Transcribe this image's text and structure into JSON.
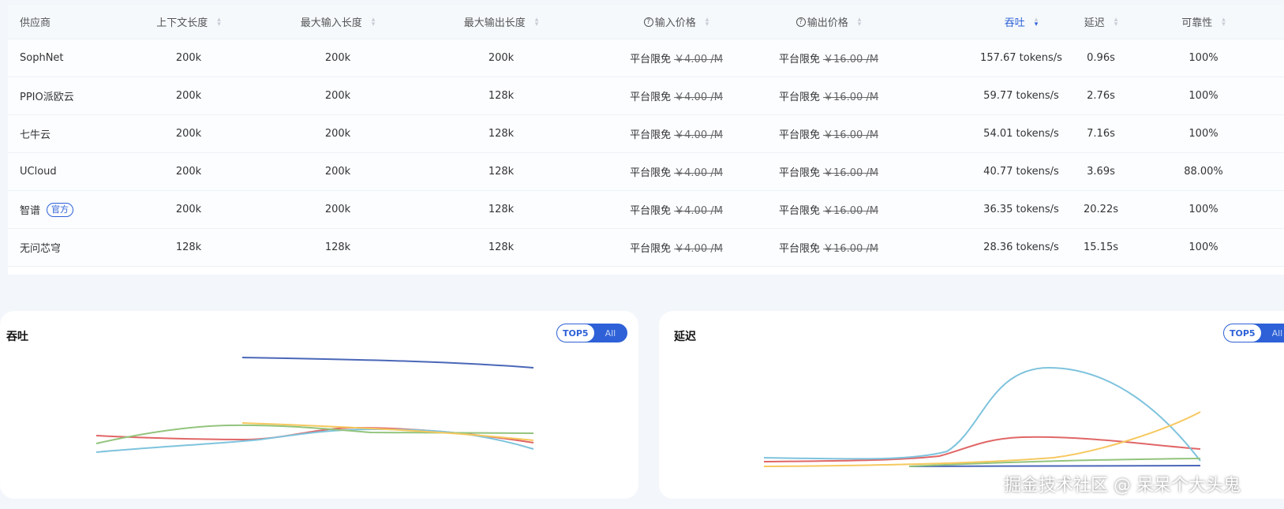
{
  "table": {
    "headers": [
      "供应商",
      "上下文长度",
      "最大输入长度",
      "最大输出长度",
      "输入价格",
      "输出价格",
      "吞吐",
      "延迟",
      "可靠性"
    ],
    "rows": [
      {
        "provider": "SophNet",
        "badge": "",
        "context": "200k",
        "max_in": "200k",
        "max_out": "200k",
        "in_free": "平台限免",
        "in_price": "￥4.00 /M",
        "out_free": "平台限免",
        "out_price": "￥16.00 /M",
        "throughput": "157.67 tokens/s",
        "latency": "0.96s",
        "reliability": "100%"
      },
      {
        "provider": "PPIO派欧云",
        "badge": "",
        "context": "200k",
        "max_in": "200k",
        "max_out": "128k",
        "in_free": "平台限免",
        "in_price": "￥4.00 /M",
        "out_free": "平台限免",
        "out_price": "￥16.00 /M",
        "throughput": "59.77 tokens/s",
        "latency": "2.76s",
        "reliability": "100%"
      },
      {
        "provider": "七牛云",
        "badge": "",
        "context": "200k",
        "max_in": "200k",
        "max_out": "128k",
        "in_free": "平台限免",
        "in_price": "￥4.00 /M",
        "out_free": "平台限免",
        "out_price": "￥16.00 /M",
        "throughput": "54.01 tokens/s",
        "latency": "7.16s",
        "reliability": "100%"
      },
      {
        "provider": "UCloud",
        "badge": "",
        "context": "200k",
        "max_in": "200k",
        "max_out": "128k",
        "in_free": "平台限免",
        "in_price": "￥4.00 /M",
        "out_free": "平台限免",
        "out_price": "￥16.00 /M",
        "throughput": "40.77 tokens/s",
        "latency": "3.69s",
        "reliability": "88.00%"
      },
      {
        "provider": "智谱",
        "badge": "官方",
        "context": "200k",
        "max_in": "200k",
        "max_out": "128k",
        "in_free": "平台限免",
        "in_price": "￥4.00 /M",
        "out_free": "平台限免",
        "out_price": "￥16.00 /M",
        "throughput": "36.35 tokens/s",
        "latency": "20.22s",
        "reliability": "100%"
      },
      {
        "provider": "无问芯穹",
        "badge": "",
        "context": "128k",
        "max_in": "128k",
        "max_out": "128k",
        "in_free": "平台限免",
        "in_price": "￥4.00 /M",
        "out_free": "平台限免",
        "out_price": "￥16.00 /M",
        "throughput": "28.36 tokens/s",
        "latency": "15.15s",
        "reliability": "100%"
      }
    ]
  },
  "cards": {
    "throughput_title": "吞吐",
    "latency_title": "延迟",
    "toggle_top5": "TOP5",
    "toggle_all": "All"
  },
  "colors": {
    "accent": "#2e61d7",
    "series": [
      "#4a67b8",
      "#e06666",
      "#7ec3dd",
      "#93c47d",
      "#f6c85f"
    ]
  },
  "watermark": "掘金技术社区 @ 呆呆个大头鬼"
}
